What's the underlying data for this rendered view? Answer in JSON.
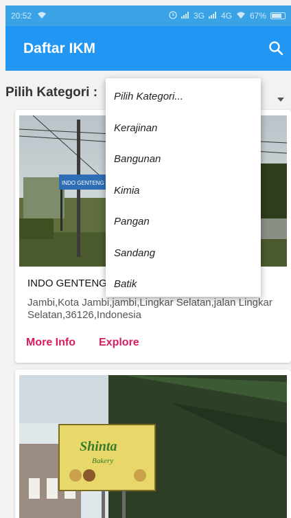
{
  "status_bar": {
    "time": "20:52",
    "network_3g": "3G",
    "network_4g": "4G",
    "battery": "67%"
  },
  "app_bar": {
    "title": "Daftar IKM",
    "search_icon": "search-icon"
  },
  "filter": {
    "label": "Pilih Kategori :"
  },
  "dropdown": {
    "options": [
      "Pilih Kategori...",
      "Kerajinan",
      "Bangunan",
      "Kimia",
      "Pangan",
      "Sandang",
      "Batik"
    ]
  },
  "cards": [
    {
      "title": "INDO GENTENG",
      "address": "Jambi,Kota Jambi,jambi,Lingkar Selatan,jalan Lingkar Selatan,36126,Indonesia",
      "sign_text": "INDO GENTENG SA...",
      "more_info_label": "More Info",
      "explore_label": "Explore"
    },
    {
      "sign_title": "Shinta",
      "sign_subtitle": "Bakery"
    }
  ],
  "colors": {
    "primary": "#2196f3",
    "status_bar": "#39a3e6",
    "accent": "#d81b60"
  }
}
